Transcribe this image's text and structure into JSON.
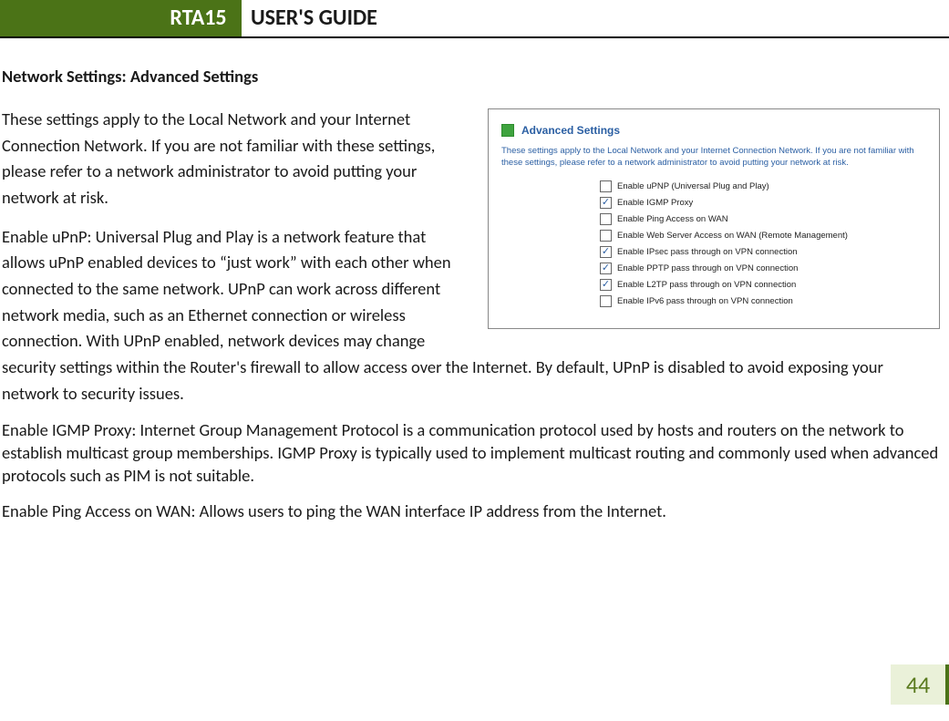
{
  "header": {
    "badge": "RTA15",
    "title": "USER'S GUIDE"
  },
  "section_title": "Network Settings: Advanced Settings",
  "paragraphs": {
    "p1": "These settings apply to the Local Network and your Internet Connection Network.  If you are not familiar with these settings, please refer to a network administrator to avoid putting your network at risk.",
    "p2": "Enable uPnP: Universal Plug and Play is a network feature that allows uPnP enabled devices to “just work” with each other when connected to the same network.  UPnP can work across different network media, such as an Ethernet connection or wireless connection.  With UPnP enabled, network devices may change security settings within the Router's firewall to allow access over the Internet.  By default, UPnP is disabled to avoid exposing your network to security issues.",
    "p3": "Enable IGMP Proxy: Internet Group Management Protocol is a communication protocol used by hosts and routers on the network to establish multicast group memberships.  IGMP Proxy is typically used to implement multicast routing and commonly used when advanced protocols such as PIM is not suitable.",
    "p4": "Enable Ping Access on WAN: Allows users to ping the WAN interface IP address from the Internet."
  },
  "screenshot": {
    "title": "Advanced Settings",
    "description": "These settings apply to the Local Network and your Internet Connection Network.  If you are not familiar with these settings, please refer to a network administrator to avoid putting your network at risk.",
    "options": [
      {
        "label": "Enable uPNP (Universal Plug and Play)",
        "checked": false
      },
      {
        "label": "Enable IGMP Proxy",
        "checked": true
      },
      {
        "label": "Enable Ping Access on WAN",
        "checked": false
      },
      {
        "label": "Enable Web Server Access on WAN (Remote Management)",
        "checked": false
      },
      {
        "label": "Enable IPsec pass through on VPN connection",
        "checked": true
      },
      {
        "label": "Enable PPTP pass through on VPN connection",
        "checked": true
      },
      {
        "label": "Enable L2TP pass through on VPN connection",
        "checked": true
      },
      {
        "label": "Enable IPv6 pass through on VPN connection",
        "checked": false
      }
    ]
  },
  "page_number": "44"
}
